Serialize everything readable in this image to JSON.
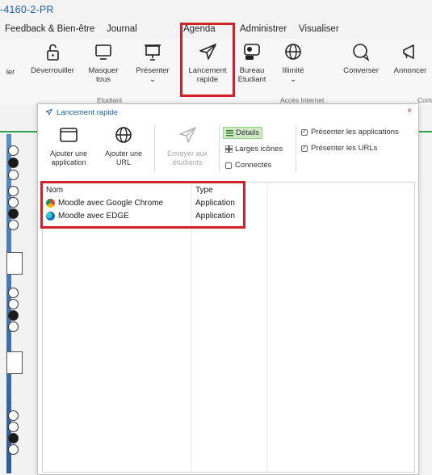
{
  "app": {
    "title": "-4160-2-PR"
  },
  "menu": [
    "Feedback & Bien-être",
    "Journal",
    "Agenda",
    "Administrer",
    "Visualiser"
  ],
  "ribbon": {
    "buttons": [
      {
        "id": "ler",
        "label": "ler",
        "icon": "none"
      },
      {
        "id": "unlock",
        "label": "Déverrouiller",
        "icon": "unlock-icon"
      },
      {
        "id": "hide",
        "label": "Masquer tous",
        "icon": "monitor-icon"
      },
      {
        "id": "present",
        "label": "Présenter",
        "icon": "presentation-icon"
      },
      {
        "id": "quicklaunch",
        "label": "Lancement rapide",
        "icon": "send-icon"
      },
      {
        "id": "desktop",
        "label": "Bureau Etudiant",
        "icon": "student-desktop-icon"
      },
      {
        "id": "unlimited",
        "label": "Illimité",
        "icon": "globe-icon"
      },
      {
        "id": "chat",
        "label": "Converser",
        "icon": "chat-icon"
      },
      {
        "id": "announce",
        "label": "Annoncer",
        "icon": "megaphone-icon"
      }
    ],
    "groups": {
      "student": "Etudiant",
      "internet": "Accès Internet",
      "comm": "Com"
    }
  },
  "popup": {
    "title": "Lancement rapide",
    "close": "×",
    "tools": [
      {
        "id": "add_app",
        "label": "Ajouter une application",
        "icon": "window-icon",
        "enabled": true
      },
      {
        "id": "add_url",
        "label": "Ajouter une URL",
        "icon": "globe-icon",
        "enabled": true
      },
      {
        "id": "send",
        "label": "Envoyer aux étudiants",
        "icon": "send-icon",
        "enabled": false
      }
    ],
    "views": {
      "details": "Détails",
      "large": "Larges icônes",
      "connected": "Connectés"
    },
    "options": {
      "present_apps": "Présenter les applications",
      "present_urls": "Présenter les URLs"
    },
    "columns": {
      "name": "Nom",
      "type": "Type"
    },
    "rows": [
      {
        "name": "Moodle avec Google Chrome",
        "type": "Application",
        "icon": "chrome-icon"
      },
      {
        "name": "Moodle avec EDGE",
        "type": "Application",
        "icon": "edge-icon"
      }
    ]
  },
  "colors": {
    "accent": "#1f5fa8",
    "highlight": "#d0202a",
    "active_view": "#cfe9c7"
  }
}
